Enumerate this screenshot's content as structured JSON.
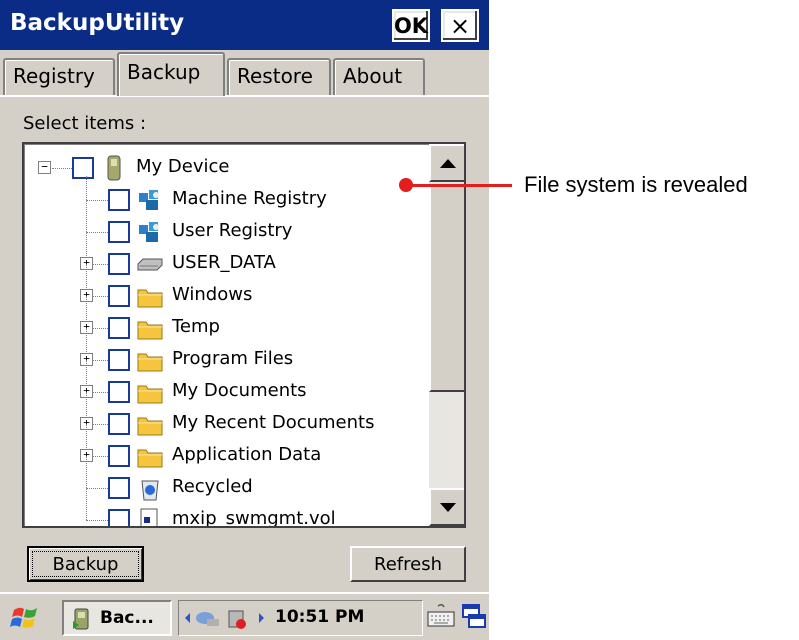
{
  "window": {
    "title": "BackupUtility",
    "ok_label": "OK",
    "close_label": "×"
  },
  "tabs": [
    {
      "label": "Registry",
      "active": false
    },
    {
      "label": "Backup",
      "active": true
    },
    {
      "label": "Restore",
      "active": false
    },
    {
      "label": "About",
      "active": false
    }
  ],
  "select_label": "Select items :",
  "tree": {
    "nodes": [
      {
        "label": "My Device",
        "icon": "pda-device-icon",
        "expander": "−"
      },
      {
        "label": "Machine Registry",
        "icon": "registry-icon",
        "expander": ""
      },
      {
        "label": "User Registry",
        "icon": "registry-icon",
        "expander": ""
      },
      {
        "label": "USER_DATA",
        "icon": "drive-icon",
        "expander": "+"
      },
      {
        "label": "Windows",
        "icon": "folder-icon",
        "expander": "+"
      },
      {
        "label": "Temp",
        "icon": "folder-icon",
        "expander": "+"
      },
      {
        "label": "Program Files",
        "icon": "folder-icon",
        "expander": "+"
      },
      {
        "label": "My Documents",
        "icon": "folder-icon",
        "expander": "+"
      },
      {
        "label": "My Recent Documents",
        "icon": "folder-icon",
        "expander": "+"
      },
      {
        "label": "Application Data",
        "icon": "folder-icon",
        "expander": "+"
      },
      {
        "label": "Recycled",
        "icon": "recycle-bin-icon",
        "expander": ""
      },
      {
        "label": "mxip_swmgmt.vol",
        "icon": "file-icon",
        "expander": ""
      }
    ]
  },
  "buttons": {
    "backup": "Backup",
    "refresh": "Refresh"
  },
  "taskbar": {
    "task_label": "Bac...",
    "clock": "10:51 PM"
  },
  "annotation": {
    "text": "File system is revealed"
  },
  "colors": {
    "title_bar": "#0a2c86",
    "checkbox_border": "#1a3a9a",
    "callout": "#e41e1e",
    "folder": "#f5c542"
  }
}
